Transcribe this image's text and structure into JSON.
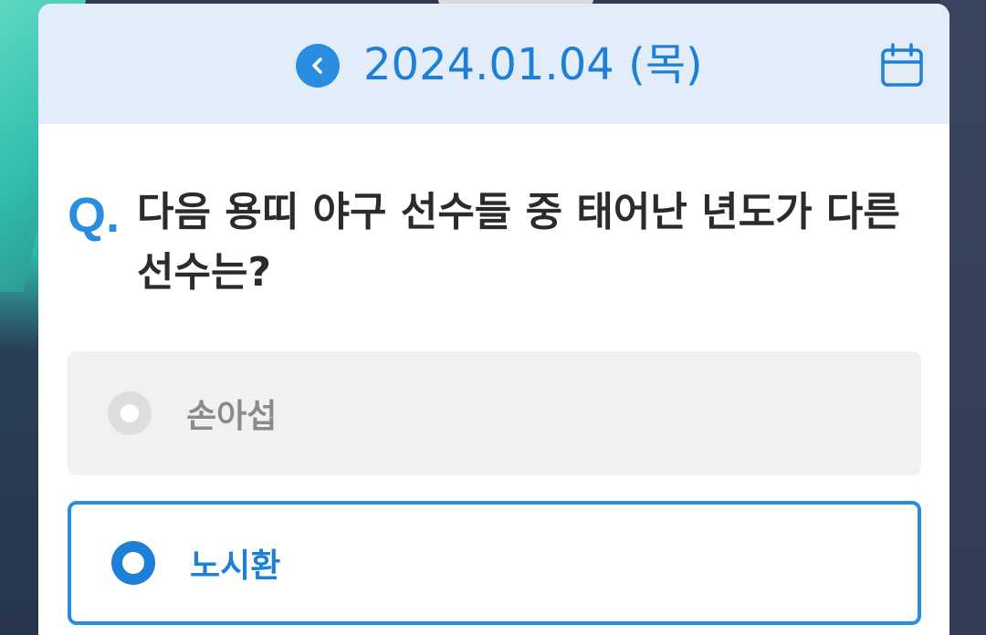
{
  "header": {
    "date": "2024.01.04 (목)",
    "prev_icon": "chevron-left-icon",
    "calendar_icon": "calendar-icon"
  },
  "question": {
    "prefix": "Q.",
    "text": "다음 용띠 야구 선수들 중 태어난 년도가 다른 선수는?"
  },
  "options": [
    {
      "label": "손아섭",
      "selected": false
    },
    {
      "label": "노시환",
      "selected": true
    }
  ],
  "colors": {
    "accent": "#2a8de0",
    "header_bg": "#e2edf9",
    "option_unselected_bg": "#f1f1f1"
  }
}
